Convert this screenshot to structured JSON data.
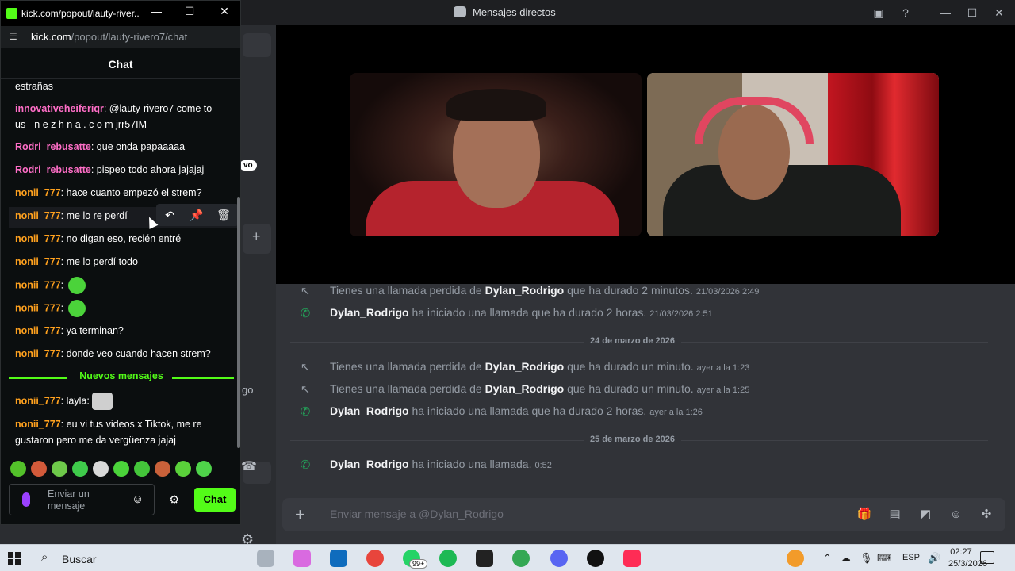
{
  "kick": {
    "window_title": "kick.com/popout/lauty-river...",
    "url_host": "kick.com",
    "url_path": "/popout/lauty-rivero7/chat",
    "chat_header": "Chat",
    "messages": [
      {
        "user": "",
        "text": "estrañas"
      },
      {
        "user": "innovativeheiferiqr",
        "text": ": @lauty-rivero7 come to"
      },
      {
        "user": "",
        "text": "us - n e z h n a . c o m jrr57IM"
      },
      {
        "user": "Rodri_rebusatte",
        "text": ": que onda papaaaaa"
      },
      {
        "user": "Rodri_rebusatte",
        "text": ": pispeo todo ahora jajajaj"
      },
      {
        "user": "nonii_777",
        "text": ": hace cuanto empezó el strem?"
      },
      {
        "user": "nonii_777",
        "text": ": me lo re perdí"
      },
      {
        "user": "nonii_777",
        "text": ": no digan eso, recién entré"
      },
      {
        "user": "nonii_777",
        "text": ": me lo perdí todo"
      },
      {
        "user": "nonii_777",
        "text": ":"
      },
      {
        "user": "nonii_777",
        "text": ":"
      },
      {
        "user": "nonii_777",
        "text": ": ya terminan?"
      },
      {
        "user": "nonii_777",
        "text": ": donde veo cuando hacen strem?"
      },
      {
        "user": "nonii_777",
        "text": ": layla:"
      },
      {
        "user": "nonii_777",
        "text": ": eu vi tus videos x Tiktok, me re"
      },
      {
        "user": "",
        "text": "gustaron pero me da vergüenza jajaj"
      }
    ],
    "new_messages_label": "Nuevos mensajes",
    "input_placeholder_line1": "Enviar un",
    "input_placeholder_line2": "mensaje",
    "send_label": "Chat",
    "colors": {
      "accent": "#53fc18",
      "pink": "#ff6ec7",
      "orange": "#ffa11e"
    }
  },
  "discord": {
    "window_title": "Mensajes directos",
    "sidebar_badge": "vo",
    "sidebar_fragment": "go",
    "log": [
      {
        "type": "missed",
        "prefix": "Tienes una llamada perdida de ",
        "user": "Dylan_Rodrigo",
        "suffix": " que ha durado 2 minutos.",
        "time": "21/03/2026 2:49"
      },
      {
        "type": "started",
        "prefix": "",
        "user": "Dylan_Rodrigo",
        "suffix": " ha iniciado una llamada que ha durado 2 horas.",
        "time": "21/03/2026 2:51"
      },
      {
        "type": "missed",
        "prefix": "Tienes una llamada perdida de ",
        "user": "Dylan_Rodrigo",
        "suffix": " que ha durado un minuto.",
        "time": "ayer a la 1:23"
      },
      {
        "type": "missed",
        "prefix": "Tienes una llamada perdida de ",
        "user": "Dylan_Rodrigo",
        "suffix": " que ha durado un minuto.",
        "time": "ayer a la 1:25"
      },
      {
        "type": "started",
        "prefix": "",
        "user": "Dylan_Rodrigo",
        "suffix": " ha iniciado una llamada que ha durado 2 horas.",
        "time": "ayer a la 1:26"
      },
      {
        "type": "started",
        "prefix": "",
        "user": "Dylan_Rodrigo",
        "suffix": " ha iniciado una llamada.",
        "time": "0:52"
      }
    ],
    "date_dividers": [
      "24 de marzo de 2026",
      "25 de marzo de 2026"
    ],
    "input_placeholder": "Enviar mensaje a @Dylan_Rodrigo"
  },
  "taskbar": {
    "search_label": "Buscar",
    "whatsapp_badge": "99+",
    "language": "ESP",
    "time": "02:27",
    "date": "25/3/2026"
  }
}
